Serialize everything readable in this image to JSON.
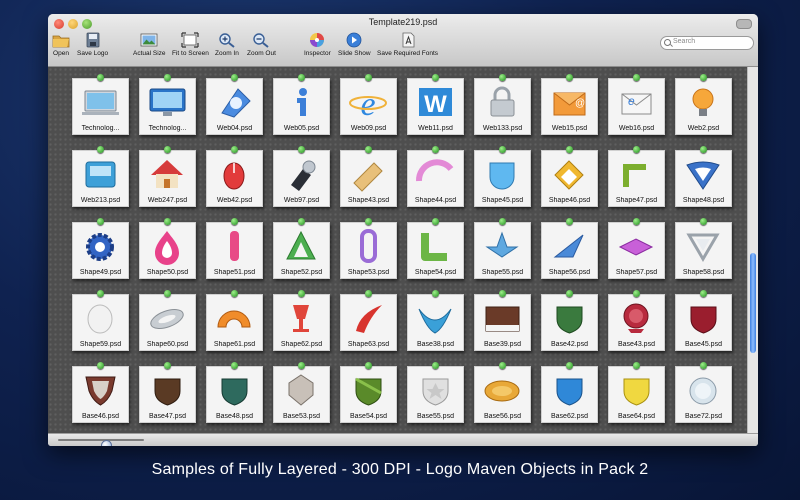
{
  "window": {
    "title": "Template219.psd",
    "search_placeholder": "Search"
  },
  "toolbar": [
    {
      "label": "Open",
      "icon": "folder-icon"
    },
    {
      "label": "Save Logo",
      "icon": "save-disk-icon"
    },
    {
      "label": "Actual Size",
      "icon": "image-icon"
    },
    {
      "label": "Fit to Screen",
      "icon": "fit-screen-icon"
    },
    {
      "label": "Zoom In",
      "icon": "zoom-in-icon"
    },
    {
      "label": "Zoom Out",
      "icon": "zoom-out-icon"
    },
    {
      "label": "Inspector",
      "icon": "color-wheel-icon"
    },
    {
      "label": "Slide Show",
      "icon": "play-icon"
    },
    {
      "label": "Save Required Fonts",
      "icon": "font-document-icon"
    }
  ],
  "files": [
    "Technolog...",
    "Technolog...",
    "Web04.psd",
    "Web05.psd",
    "Web09.psd",
    "Web11.psd",
    "Web133.psd",
    "Web15.psd",
    "Web16.psd",
    "Web2.psd",
    "Web213.psd",
    "Web247.psd",
    "Web42.psd",
    "Web97.psd",
    "Shape43.psd",
    "Shape44.psd",
    "Shape45.psd",
    "Shape46.psd",
    "Shape47.psd",
    "Shape48.psd",
    "Shape49.psd",
    "Shape50.psd",
    "Shape51.psd",
    "Shape52.psd",
    "Shape53.psd",
    "Shape54.psd",
    "Shape55.psd",
    "Shape56.psd",
    "Shape57.psd",
    "Shape58.psd",
    "Shape59.psd",
    "Shape60.psd",
    "Shape61.psd",
    "Shape62.psd",
    "Shape63.psd",
    "Base38.psd",
    "Base39.psd",
    "Base42.psd",
    "Base43.psd",
    "Base45.psd",
    "Base46.psd",
    "Base47.psd",
    "Base48.psd",
    "Base53.psd",
    "Base54.psd",
    "Base55.psd",
    "Base56.psd",
    "Base62.psd",
    "Base64.psd",
    "Base72.psd"
  ],
  "zoom_level": 0.55,
  "caption": "Samples of  Fully Layered - 300 DPI - Logo Maven Objects in Pack 2",
  "colors": {
    "background": "#0f2250",
    "pin": "#2f9a2a",
    "accent": "#3d7fe0"
  }
}
